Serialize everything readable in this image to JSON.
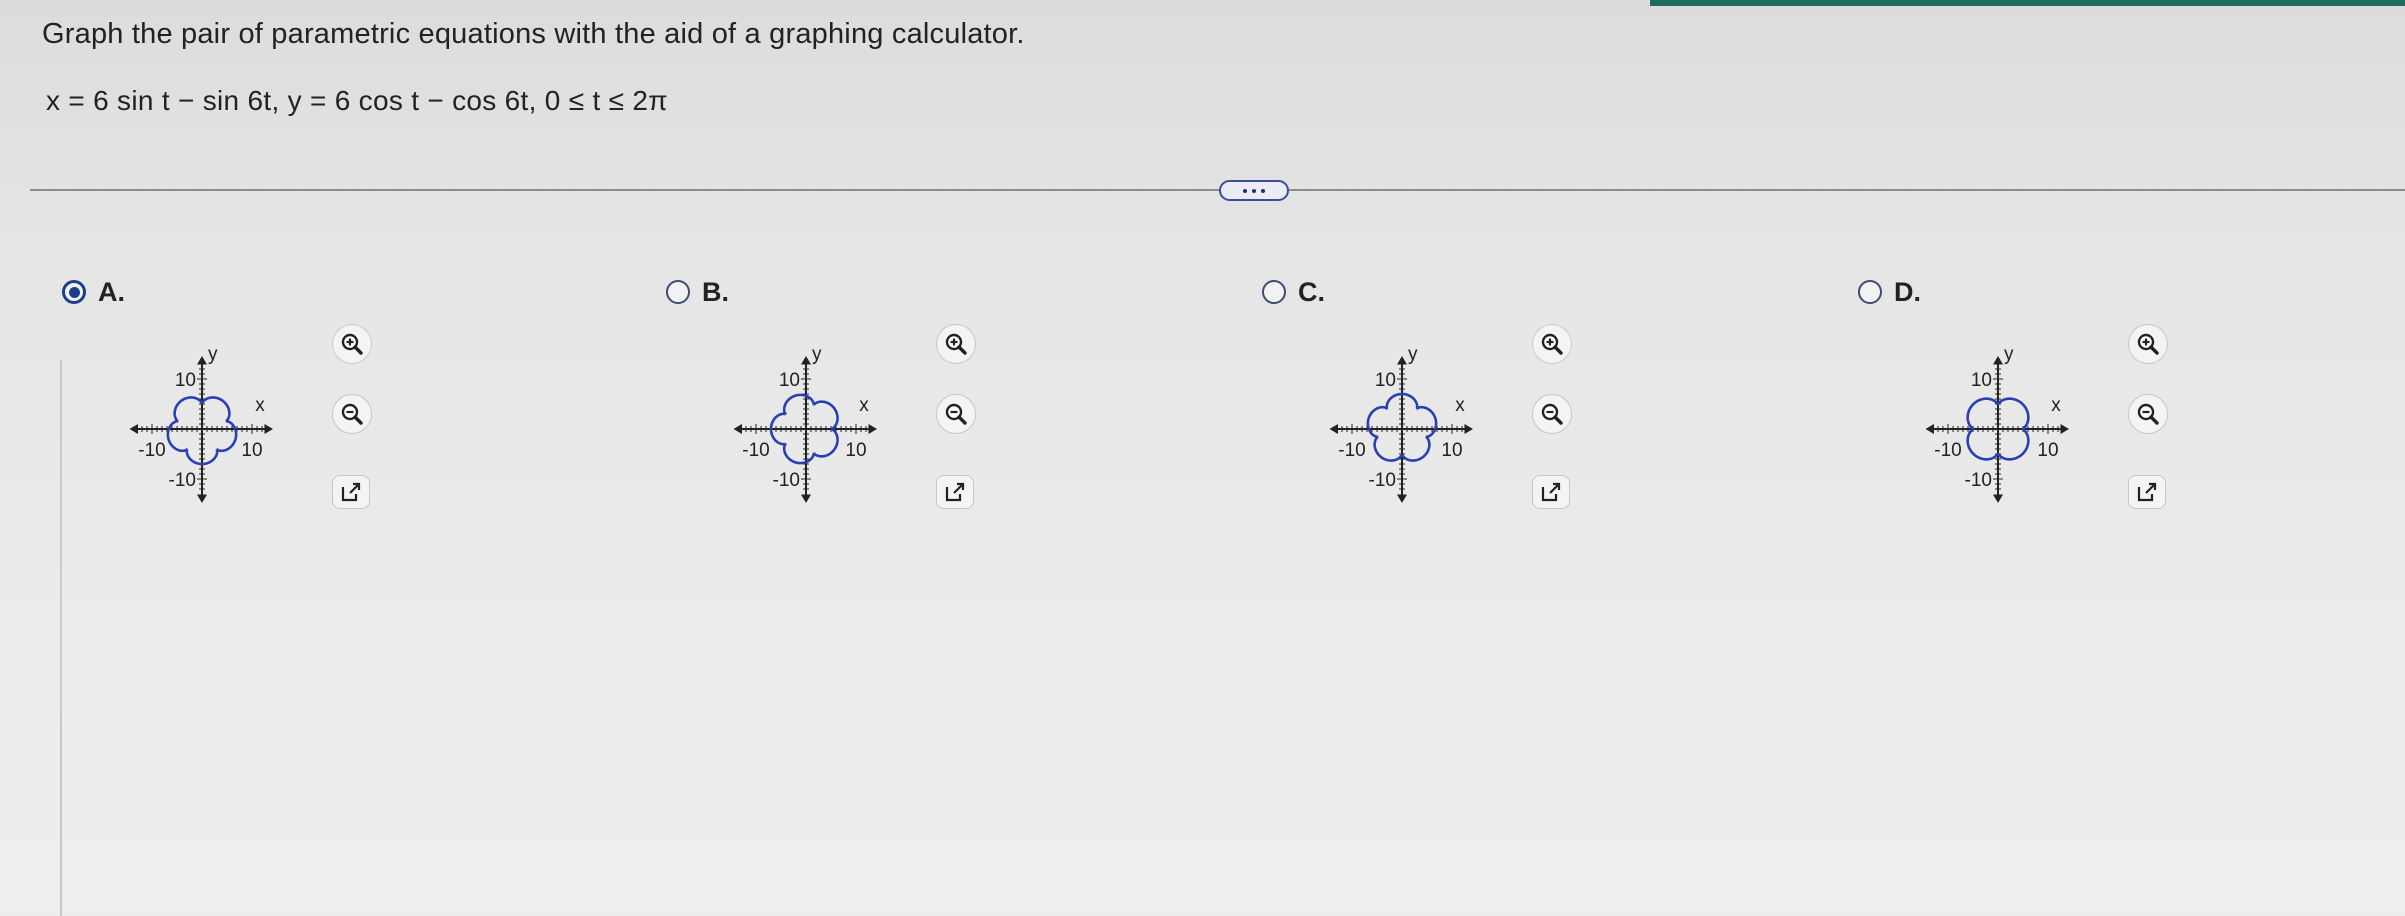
{
  "question": {
    "prompt": "Graph the pair of parametric equations with the aid of a graphing calculator.",
    "equation": "x = 6 sin t − sin 6t, y = 6 cos t − cos 6t, 0 ≤ t ≤ 2π"
  },
  "more_button": {
    "icon": "ellipsis-icon"
  },
  "options": [
    {
      "label": "A.",
      "selected": true,
      "axis": {
        "x_label": "x",
        "y_label": "y",
        "pos_tick": "10",
        "neg_tick_x": "-10",
        "neg_tick_y": "-10"
      }
    },
    {
      "label": "B.",
      "selected": false,
      "axis": {
        "x_label": "x",
        "y_label": "y",
        "pos_tick": "10",
        "neg_tick_x": "-10",
        "neg_tick_y": "-10"
      }
    },
    {
      "label": "C.",
      "selected": false,
      "axis": {
        "x_label": "x",
        "y_label": "y",
        "pos_tick": "10",
        "neg_tick_x": "-10",
        "neg_tick_y": "-10"
      }
    },
    {
      "label": "D.",
      "selected": false,
      "axis": {
        "x_label": "x",
        "y_label": "y",
        "pos_tick": "10",
        "neg_tick_x": "-10",
        "neg_tick_y": "-10"
      }
    }
  ],
  "colors": {
    "curve": "#2a3fb0",
    "accent": "#1c3f8c",
    "axis": "#222222"
  },
  "tool_icons": [
    "zoom-in-icon",
    "zoom-out-icon",
    "open-new-window-icon"
  ]
}
